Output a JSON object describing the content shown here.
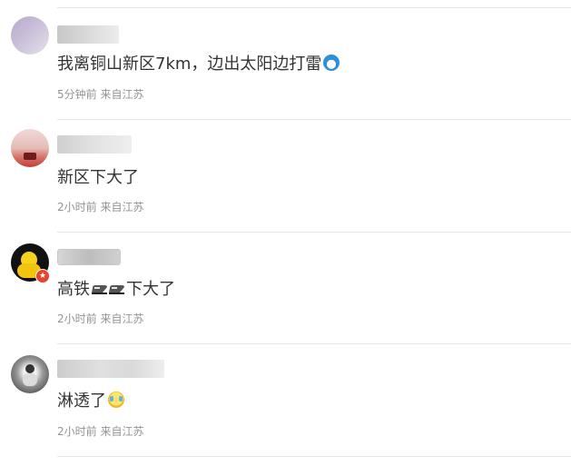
{
  "comments": [
    {
      "text": "我离铜山新区7km，边出太阳边打雷",
      "time_source": "5分钟前 来自江苏",
      "emoji": "doraemon-emoji"
    },
    {
      "text": "新区下大了",
      "time_source": "2小时前 来自江苏"
    },
    {
      "text_before": "高铁",
      "text_after": "下大了",
      "time_source": "2小时前 来自江苏",
      "emoji": "train-emoji"
    },
    {
      "text": "淋透了",
      "time_source": "2小时前 来自江苏",
      "emoji": "laugh-cry-emoji"
    }
  ],
  "colors": {
    "text": "#333333",
    "meta": "#939393",
    "divider": "#e6e6e6",
    "verified_badge": "#e8432b"
  }
}
